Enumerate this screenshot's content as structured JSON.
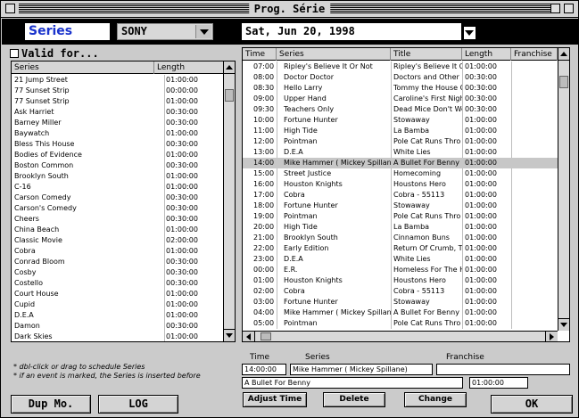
{
  "window": {
    "title": "Prog. Série"
  },
  "topbar": {
    "series_label": "Series",
    "channel": "SONY",
    "date": "Sat, Jun 20, 1998"
  },
  "valid_for": {
    "label": "Valid for..."
  },
  "series_list": {
    "columns": [
      "Series",
      "Length"
    ],
    "rows": [
      [
        "21 Jump Street",
        "01:00:00"
      ],
      [
        "77 Sunset Strip",
        "00:00:00"
      ],
      [
        "77 Sunset Strip",
        "01:00:00"
      ],
      [
        "Ask Harriet",
        "00:30:00"
      ],
      [
        "Barney Miller",
        "00:30:00"
      ],
      [
        "Baywatch",
        "01:00:00"
      ],
      [
        "Bless This House",
        "00:30:00"
      ],
      [
        "Bodies of Evidence",
        "01:00:00"
      ],
      [
        "Boston Common",
        "00:30:00"
      ],
      [
        "Brooklyn South",
        "01:00:00"
      ],
      [
        "C-16",
        "01:00:00"
      ],
      [
        "Carson Comedy",
        "00:30:00"
      ],
      [
        "Carson's Comedy",
        "00:30:00"
      ],
      [
        "Cheers",
        "00:30:00"
      ],
      [
        "China Beach",
        "01:00:00"
      ],
      [
        "Classic Movie",
        "02:00:00"
      ],
      [
        "Cobra",
        "01:00:00"
      ],
      [
        "Conrad Bloom",
        "00:30:00"
      ],
      [
        "Cosby",
        "00:30:00"
      ],
      [
        "Costello",
        "00:30:00"
      ],
      [
        "Court House",
        "01:00:00"
      ],
      [
        "Cupid",
        "01:00:00"
      ],
      [
        "D.E.A",
        "01:00:00"
      ],
      [
        "Damon",
        "00:30:00"
      ],
      [
        "Dark Skies",
        "01:00:00"
      ]
    ]
  },
  "schedule": {
    "columns": [
      "Time",
      "Series",
      "Title",
      "Length",
      "Franchise"
    ],
    "rows": [
      [
        "07:00",
        "Ripley's Believe It Or Not",
        "Ripley's Believe It O",
        "01:00:00",
        ""
      ],
      [
        "08:00",
        "Doctor Doctor",
        "Doctors and Other",
        "00:30:00",
        ""
      ],
      [
        "08:30",
        "Hello Larry",
        "Tommy the House G",
        "00:30:00",
        ""
      ],
      [
        "09:00",
        "Upper Hand",
        "Caroline's First Nigh",
        "00:30:00",
        ""
      ],
      [
        "09:30",
        "Teachers Only",
        "Dead Mice Don't We",
        "00:30:00",
        ""
      ],
      [
        "10:00",
        "Fortune Hunter",
        "Stowaway",
        "01:00:00",
        ""
      ],
      [
        "11:00",
        "High Tide",
        "La Bamba",
        "01:00:00",
        ""
      ],
      [
        "12:00",
        "Pointman",
        "Pole Cat Runs Thro",
        "01:00:00",
        ""
      ],
      [
        "13:00",
        "D.E.A",
        "White Lies",
        "01:00:00",
        ""
      ],
      [
        "14:00",
        "Mike Hammer ( Mickey Spillane )",
        "A Bullet For Benny",
        "01:00:00",
        ""
      ],
      [
        "15:00",
        "Street Justice",
        "Homecoming",
        "01:00:00",
        ""
      ],
      [
        "16:00",
        "Houston Knights",
        "Houstons Hero",
        "01:00:00",
        ""
      ],
      [
        "17:00",
        "Cobra",
        "Cobra - 55113",
        "01:00:00",
        ""
      ],
      [
        "18:00",
        "Fortune Hunter",
        "Stowaway",
        "01:00:00",
        ""
      ],
      [
        "19:00",
        "Pointman",
        "Pole Cat Runs Thro",
        "01:00:00",
        ""
      ],
      [
        "20:00",
        "High Tide",
        "La Bamba",
        "01:00:00",
        ""
      ],
      [
        "21:00",
        "Brooklyn South",
        "Cinnamon Buns",
        "01:00:00",
        ""
      ],
      [
        "22:00",
        "Early Edition",
        "Return Of Crumb, T",
        "01:00:00",
        ""
      ],
      [
        "23:00",
        "D.E.A",
        "White Lies",
        "01:00:00",
        ""
      ],
      [
        "00:00",
        "E.R.",
        "Homeless For The H",
        "01:00:00",
        ""
      ],
      [
        "01:00",
        "Houston Knights",
        "Houstons Hero",
        "01:00:00",
        ""
      ],
      [
        "02:00",
        "Cobra",
        "Cobra - 55113",
        "01:00:00",
        ""
      ],
      [
        "03:00",
        "Fortune Hunter",
        "Stowaway",
        "01:00:00",
        ""
      ],
      [
        "04:00",
        "Mike Hammer ( Mickey Spillane )",
        "A Bullet For Benny",
        "01:00:00",
        ""
      ],
      [
        "05:00",
        "Pointman",
        "Pole Cat Runs Thro",
        "01:00:00",
        ""
      ]
    ],
    "selected_index": 9
  },
  "notes": {
    "line1": "* dbl-click or drag to schedule Series",
    "line2": "* if an event is marked, the Series is inserted before"
  },
  "detail": {
    "time_label": "Time",
    "series_label": "Series",
    "franchise_label": "Franchise",
    "time_value": "14:00:00",
    "series_value": "Mike Hammer ( Mickey Spillane)",
    "franchise_value": "",
    "title_value": "A Bullet For Benny",
    "length_value": "01:00:00"
  },
  "buttons": {
    "dup_mo": "Dup Mo.",
    "log": "LOG",
    "adjust_time": "Adjust Time",
    "delete": "Delete",
    "change": "Change",
    "ok": "OK"
  }
}
